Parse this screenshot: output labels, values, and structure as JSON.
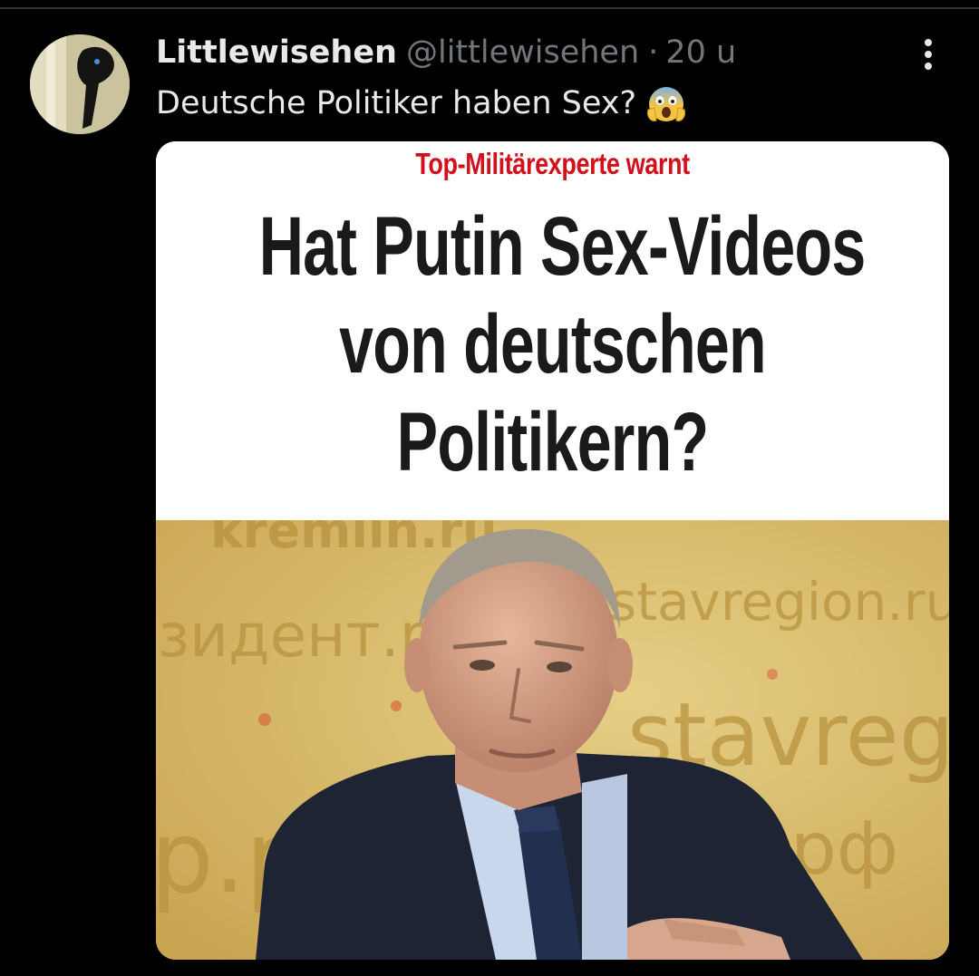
{
  "tweet": {
    "display_name": "Littlewisehen",
    "handle": "@littlewisehen",
    "separator": "·",
    "time": "20 u",
    "text": "Deutsche Politiker haben Sex?",
    "emoji": "face-screaming-in-fear-emoji",
    "more_icon": "more-vertical-icon"
  },
  "media": {
    "kicker": "Top-Militärexperte warnt",
    "headline_lines": [
      "Hat Putin Sex-Videos",
      "von deutschen",
      "Politikern?"
    ],
    "backdrop_texts": [
      "kremlin.ru",
      "зидент.р",
      "stavregion.ru",
      "stavregion",
      "р.р",
      "рф"
    ]
  },
  "colors": {
    "background": "#000000",
    "text_primary": "#e7e9ea",
    "text_secondary": "#71767b",
    "kicker_red": "#d1121c",
    "headline": "#1a1a1a",
    "photo_backdrop": "#d9bd6b"
  }
}
